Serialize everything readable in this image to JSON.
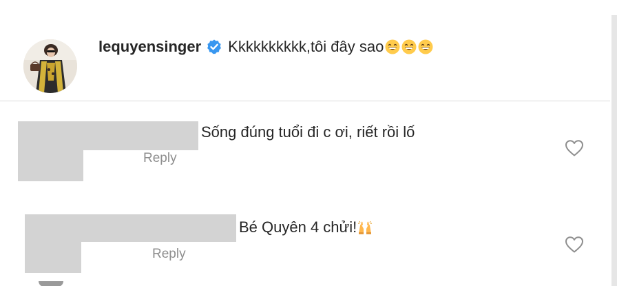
{
  "post": {
    "username": "lequyensinger",
    "verified_icon": "verified-badge-icon",
    "caption": "Kkkkkkkkkk,tôi đây sao",
    "emojis": [
      "grinning-face-emoji",
      "grinning-face-emoji",
      "grinning-face-emoji"
    ]
  },
  "comments": [
    {
      "text": "Sống đúng tuổi đi c ơi, riết rồi lố",
      "reply_label": "Reply",
      "like_icon": "heart-icon"
    },
    {
      "text": "Bé Quyên 4 chửi!",
      "emoji": "raising-hands-emoji",
      "reply_label": "Reply",
      "like_icon": "heart-icon"
    }
  ],
  "colors": {
    "verified_blue": "#3897f0",
    "secondary_text": "#8e8e8e",
    "redaction": "#d3d3d3",
    "divider": "#dbdbdb"
  }
}
